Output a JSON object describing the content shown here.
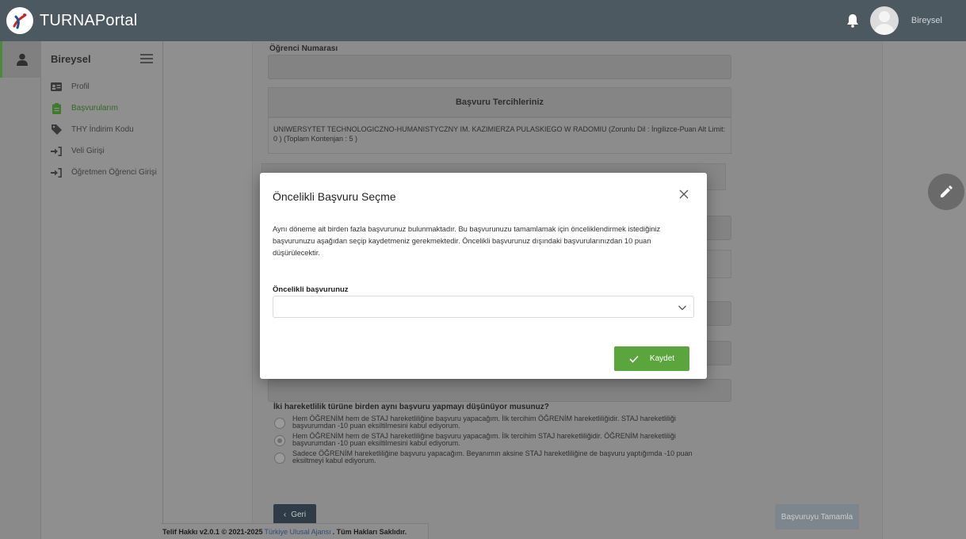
{
  "app": {
    "brand": "TURNAPortal",
    "user_name": "Bireysel"
  },
  "sidebar": {
    "title": "Bireysel",
    "items": [
      {
        "label": "Profil",
        "icon": "id-card-icon"
      },
      {
        "label": "Başvurularım",
        "icon": "clipboard-icon"
      },
      {
        "label": "THY İndirim Kodu",
        "icon": "tag-icon"
      },
      {
        "label": "Veli Girişi",
        "icon": "sign-in-icon"
      },
      {
        "label": "Öğretmen Öğrenci Girişi",
        "icon": "sign-in-icon"
      }
    ]
  },
  "form": {
    "student_number_label": "Öğrenci Numarası",
    "preferences_header": "Başvuru Tercihleriniz",
    "preference_text": "UNIWERSYTET TECHNOLOGICZNO-HUMANISTYCZNY IM. KAZIMIERZA PULASKIEGO W RADOMIU (Zorunlu Dil : İngilizce-Puan Alt Limit: 0 ) (Toplam Kontenjan : 5 )",
    "question": "İki hareketlilik türüne birden aynı başvuru yapmayı düşünüyor musunuz?",
    "options": [
      {
        "text": "Hem ÖĞRENİM hem de STAJ hareketliliğine başvuru yapacağım. İlk tercihim ÖĞRENİM hareketliliğidir. STAJ hareketliliği başvurumdan -10 puan eksiltilmesini kabul ediyorum.",
        "checked": false
      },
      {
        "text": "Hem ÖĞRENİM hem de STAJ hareketliliğine başvuru yapacağım. İlk tercihim STAJ hareketliliğidir. ÖĞRENİM hareketliliği başvurumdan -10 puan eksiltilmesini kabul ediyorum.",
        "checked": true
      },
      {
        "text": "Sadece ÖĞRENİM hareketliliğine başvuru yapacağım. Beyanımın aksine STAJ hareketliliğine de başvuru yaptığımda -10 puan eksiltmeyi kabul ediyorum.",
        "checked": false
      }
    ],
    "back_label": "Geri",
    "finish_label": "Başvuruyu Tamamla"
  },
  "footer": {
    "prefix": "Telif Hakkı v2.0.1 © 2021-2025",
    "link": "Türkiye Ulusal Ajansı",
    "suffix": ". Tüm Hakları Saklıdır."
  },
  "modal": {
    "title": "Öncelikli Başvuru Seçme",
    "text": "Aynı döneme ait birden fazla başvurunuz bulunmaktadır. Bu başvurunuzu tamamlamak için önceliklendirmek istediğiniz başvurunuzu aşağıdan seçip kaydetmeniz gerekmektedir. Öncelikli başvurunuz dışındaki başvurularınızdan 10 puan düşürülecektir.",
    "select_label": "Öncelikli başvurunuz",
    "select_value": "",
    "save_label": "Kaydet"
  },
  "colors": {
    "topbar": "#4d5961",
    "accent_green": "#5aa63c",
    "overlay_gray": "#8f8f8f"
  }
}
